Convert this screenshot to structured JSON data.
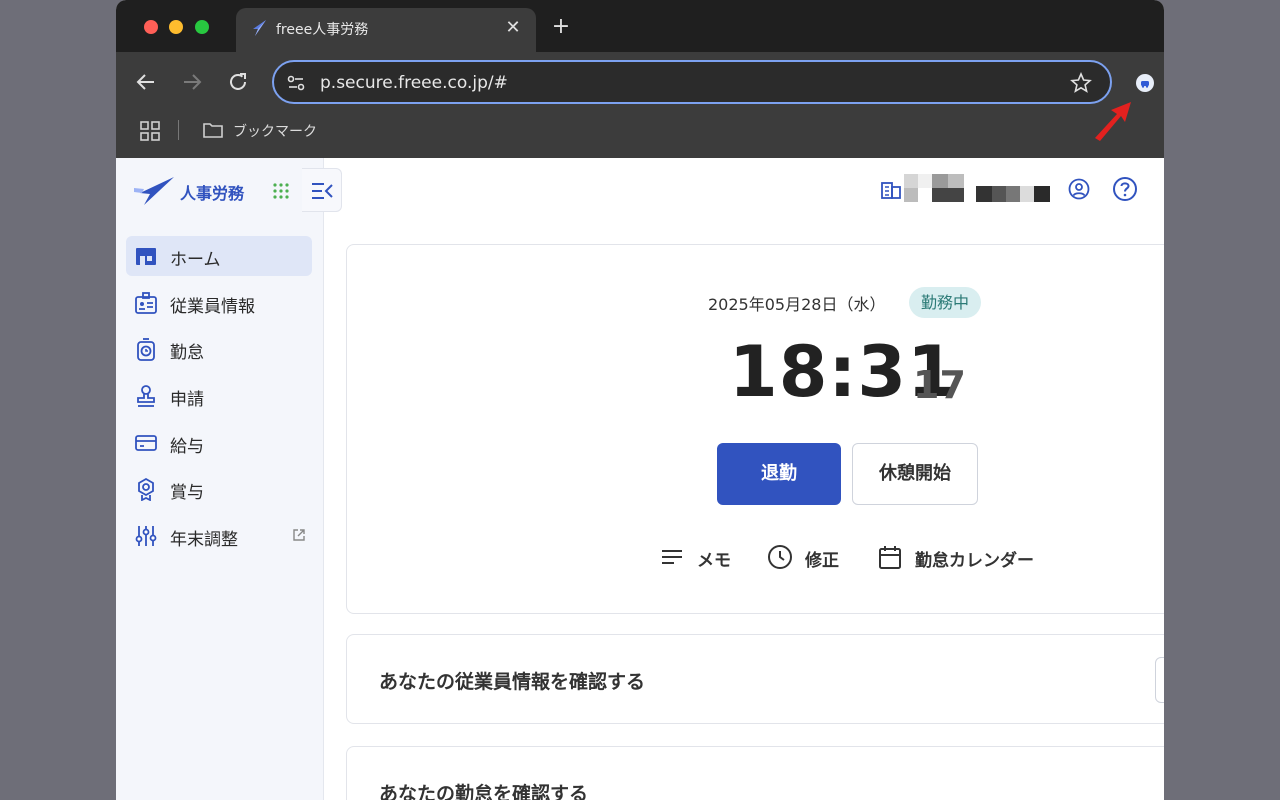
{
  "browser": {
    "tab_title": "freee人事労務",
    "tab_close": "✕",
    "new_tab": "+",
    "url": "p.secure.freee.co.jp/#",
    "bookmark_folder": "ブックマーク"
  },
  "app": {
    "logo_text": "人事労務",
    "brand_color": "#3153bf"
  },
  "sidebar": {
    "items": [
      {
        "label": "ホーム",
        "icon": "home-icon",
        "active": true
      },
      {
        "label": "従業員情報",
        "icon": "employee-card-icon"
      },
      {
        "label": "勤怠",
        "icon": "stopwatch-icon"
      },
      {
        "label": "申請",
        "icon": "stamp-icon"
      },
      {
        "label": "給与",
        "icon": "card-icon"
      },
      {
        "label": "賞与",
        "icon": "award-icon"
      },
      {
        "label": "年末調整",
        "icon": "sliders-icon",
        "external": true
      }
    ]
  },
  "clock": {
    "date": "2025年05月28日（水）",
    "status": "勤務中",
    "time": "18:31",
    "seconds": "17",
    "primary_button": "退勤",
    "secondary_button": "休憩開始",
    "actions": [
      {
        "label": "メモ",
        "icon": "memo-icon"
      },
      {
        "label": "修正",
        "icon": "clock-icon"
      },
      {
        "label": "勤怠カレンダー",
        "icon": "calendar-icon"
      }
    ]
  },
  "cards": {
    "employee_info": "あなたの従業員情報を確認する",
    "attendance": "あなたの勤怠を確認する"
  }
}
